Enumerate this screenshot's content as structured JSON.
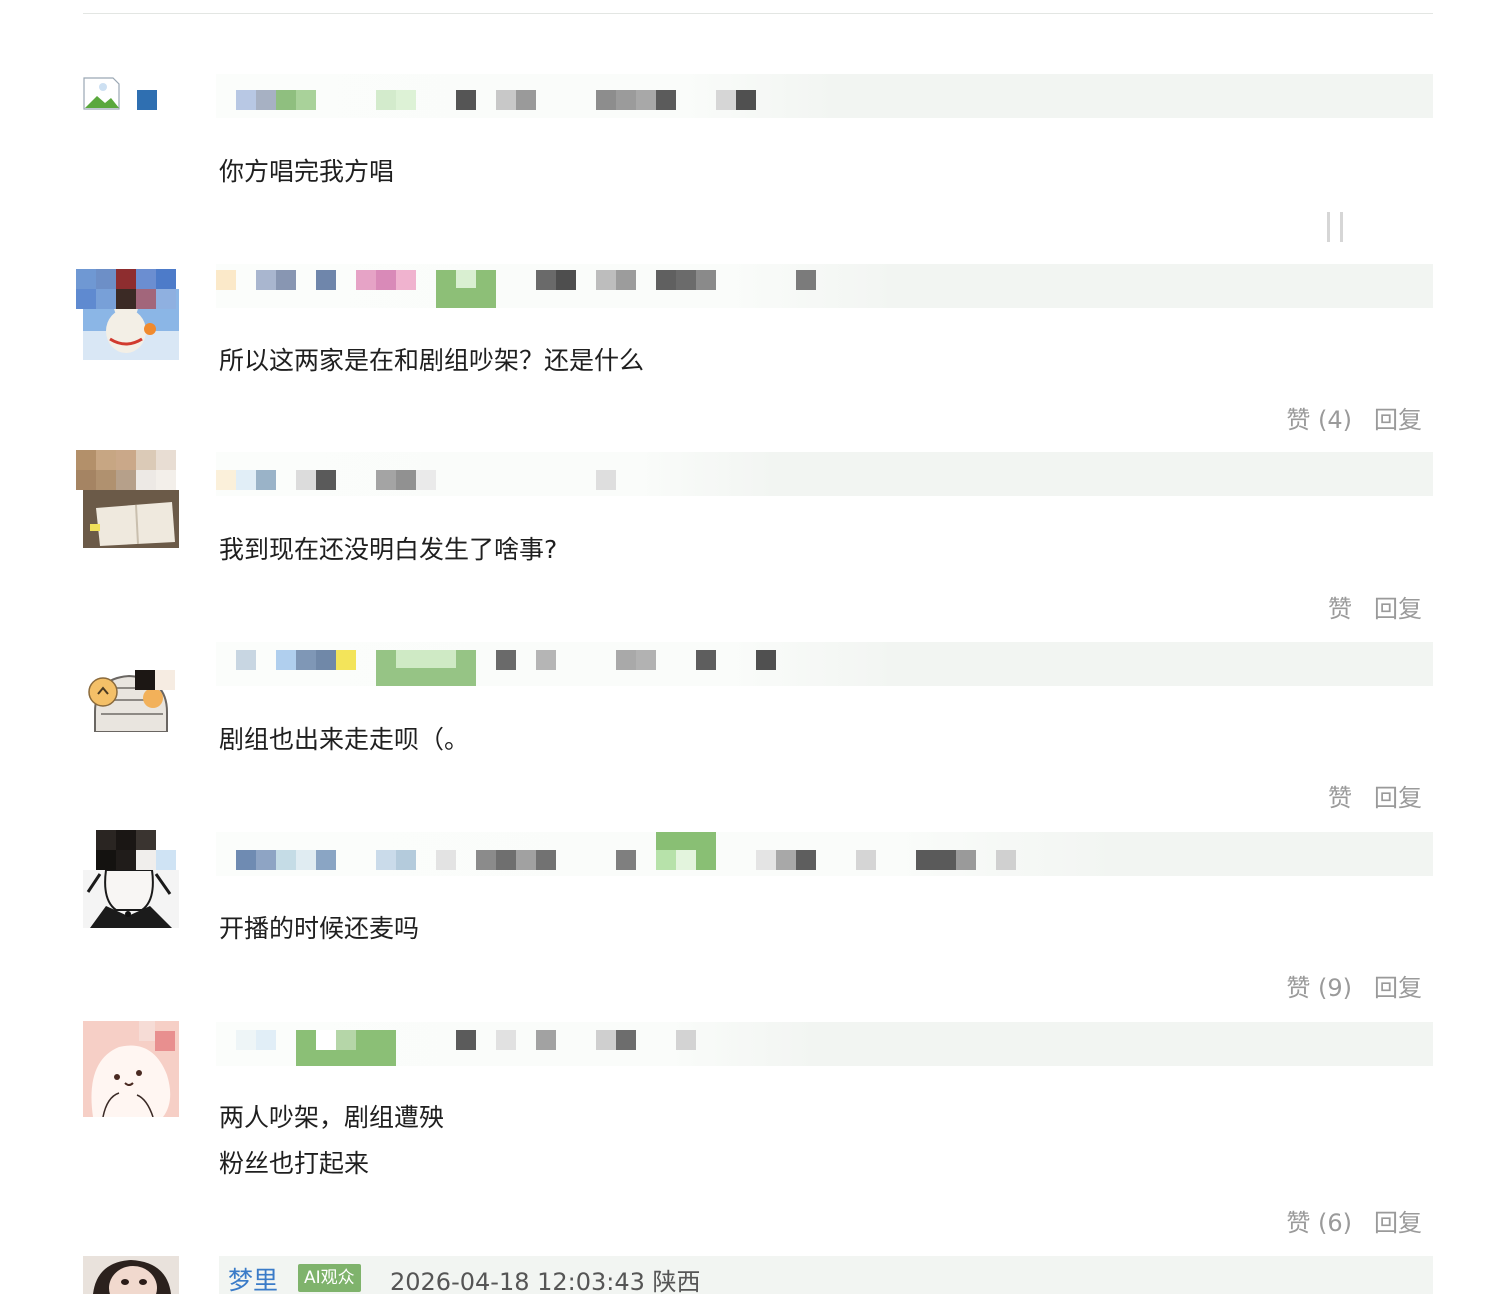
{
  "comments": [
    {
      "text": "你方唱完我方唱",
      "like_label": "",
      "reply_label": ""
    },
    {
      "text": "所以这两家是在和剧组吵架？还是什么",
      "like_label": "赞 (4)",
      "reply_label": "回复"
    },
    {
      "text": "我到现在还没明白发生了啥事?",
      "like_label": "赞",
      "reply_label": "回复"
    },
    {
      "text": "剧组也出来走走呗（。",
      "like_label": "赞",
      "reply_label": "回复"
    },
    {
      "text": "开播的时候还麦吗",
      "like_label": "赞 (9)",
      "reply_label": "回复"
    },
    {
      "text": "两人吵架，剧组遭殃\n粉丝也打起来",
      "like_label": "赞 (6)",
      "reply_label": "回复"
    }
  ],
  "last_comment": {
    "username": "梦里",
    "role_badge": "AI观众",
    "timestamp": "2026-04-18 12:03:43 陕西"
  },
  "colors": {
    "meta_bar": "#f2f5f2",
    "username": "#3a7bc8",
    "badge": "#7fb36c",
    "action_text": "#9a9a9a"
  }
}
